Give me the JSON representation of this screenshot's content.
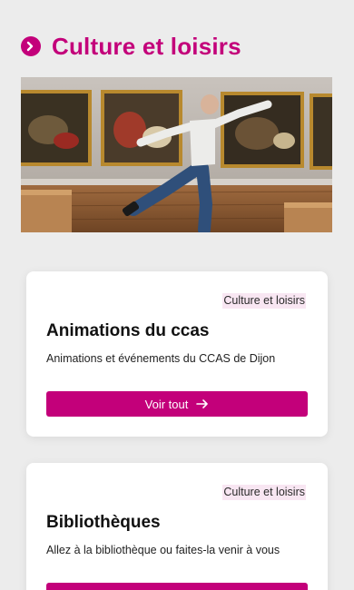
{
  "section": {
    "title": "Culture et loisirs",
    "icon": "chevron-right-circle-icon",
    "accent": "#c3007a"
  },
  "hero": {
    "alt": ""
  },
  "cards": [
    {
      "tag": "Culture et loisirs",
      "title": "Animations du ccas",
      "description": "Animations et événements du CCAS de Dijon",
      "button_label": "Voir tout"
    },
    {
      "tag": "Culture et loisirs",
      "title": "Bibliothèques",
      "description": "Allez à la bibliothèque ou faites-la venir à vous",
      "button_label": ""
    }
  ]
}
